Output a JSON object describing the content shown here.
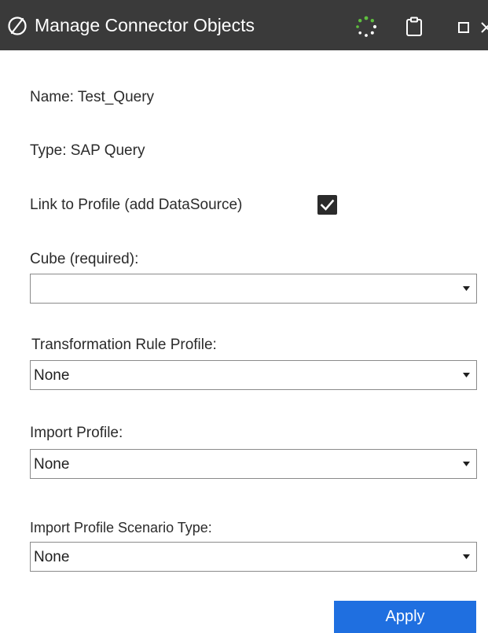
{
  "window": {
    "title": "Manage Connector Objects",
    "icons": {
      "logo": "onestream-logo-icon",
      "busy": "loading-spinner-icon",
      "clipboard": "clipboard-icon",
      "maximize": "maximize-icon",
      "close": "close-icon"
    }
  },
  "form": {
    "name_label": "Name: Test_Query",
    "type_label": "Type: SAP Query",
    "link_profile": {
      "label": "Link to Profile (add DataSource)",
      "checked": true
    },
    "cube": {
      "label": "Cube (required):",
      "value": ""
    },
    "transformation_rule_profile": {
      "label": "Transformation Rule Profile:",
      "value": "None"
    },
    "import_profile": {
      "label": "Import Profile:",
      "value": "None"
    },
    "import_profile_scenario_type": {
      "label": "Import Profile Scenario Type:",
      "value": "None"
    }
  },
  "actions": {
    "apply_label": "Apply"
  },
  "colors": {
    "titlebar": "#3a3a3a",
    "accent": "#1f6fe0",
    "spinner": "#5fbf3f"
  }
}
